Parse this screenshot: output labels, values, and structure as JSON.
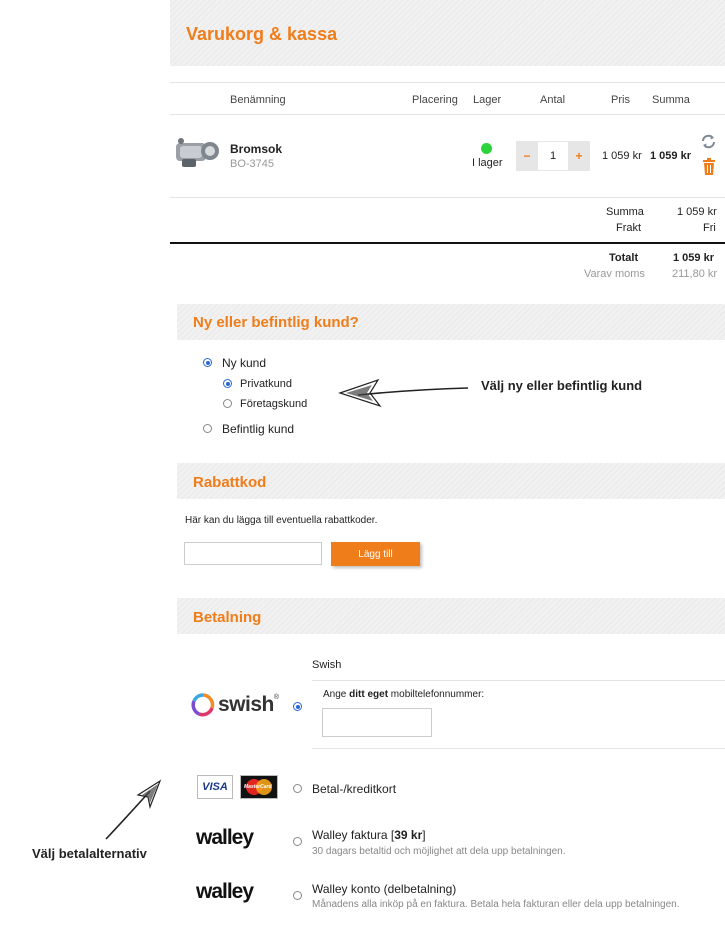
{
  "page": {
    "title": "Varukorg & kassa",
    "accent": "#ef7d1a"
  },
  "cart": {
    "headers": [
      "Benämning",
      "Placering",
      "Lager",
      "Antal",
      "Pris",
      "Summa"
    ],
    "item": {
      "name": "Bromsok",
      "sku": "BO-3745",
      "stock_label": "I lager",
      "stock_color": "#2bd43a",
      "qty": "1",
      "minus": "−",
      "plus": "+",
      "price": "1 059 kr",
      "total": "1 059 kr",
      "icons": [
        "refresh-icon",
        "trash-icon"
      ]
    },
    "summary": {
      "summa_label": "Summa",
      "summa_value": "1 059 kr",
      "frakt_label": "Frakt",
      "frakt_value": "Fri",
      "totalt_label": "Totalt",
      "totalt_value": "1 059 kr",
      "moms_label": "Varav moms",
      "moms_value": "211,80 kr"
    }
  },
  "customer": {
    "heading": "Ny eller befintlig kund?",
    "new": "Ny kund",
    "private": "Privatkund",
    "company": "Företagskund",
    "existing": "Befintlig kund",
    "annotation": "Välj ny eller befintlig kund"
  },
  "discount": {
    "heading": "Rabattkod",
    "description": "Här kan du lägga till eventuella rabattkoder.",
    "input_value": "",
    "button": "Lägg till"
  },
  "payment": {
    "heading": "Betalning",
    "swish_logo": "swish",
    "swish_title": "Swish",
    "swish_prompt_pre": "Ange ",
    "swish_prompt_bold": "ditt eget",
    "swish_prompt_post": " mobiltelefonnummer:",
    "swish_phone_value": "",
    "card_label": "Betal-/kreditkort",
    "visa": "VISA",
    "mastercard": "MasterCard",
    "walley_logo": "walley",
    "walley_invoice_title_pre": "Walley faktura [",
    "walley_invoice_price": "39 kr",
    "walley_invoice_title_post": "]",
    "walley_invoice_desc": "30 dagars betaltid och möjlighet att dela upp betalningen.",
    "walley_account_title": "Walley konto (delbetalning)",
    "walley_account_desc": "Månadens alla inköp på en faktura. Betala hela fakturan eller dela upp betalningen.",
    "annotation": "Välj betalalternativ"
  }
}
